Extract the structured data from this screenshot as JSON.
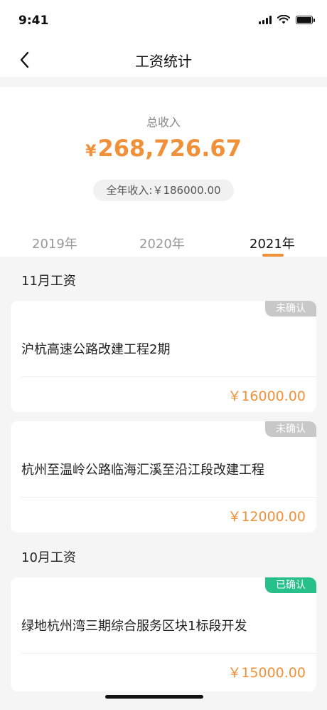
{
  "status_bar": {
    "time": "9:41"
  },
  "nav": {
    "title": "工资统计"
  },
  "summary": {
    "label": "总收入",
    "currency": "¥",
    "amount": "268,726.67",
    "annual": "全年收入:￥186000.00"
  },
  "year_tabs": [
    {
      "label": "2019年",
      "active": false
    },
    {
      "label": "2020年",
      "active": false
    },
    {
      "label": "2021年",
      "active": true
    }
  ],
  "months": [
    {
      "title": "11月工资",
      "cards": [
        {
          "badge": "未确认",
          "status": "pending",
          "project": "沪杭高速公路改建工程2期",
          "amount": "￥16000.00"
        },
        {
          "badge": "未确认",
          "status": "pending",
          "project": "杭州至温岭公路临海汇溪至沿江段改建工程",
          "amount": "￥12000.00"
        }
      ]
    },
    {
      "title": "10月工资",
      "cards": [
        {
          "badge": "已确认",
          "status": "confirmed",
          "project": "绿地杭州湾三期综合服务区块1标段开发",
          "amount": "￥15000.00"
        }
      ]
    }
  ],
  "colors": {
    "accent": "#f0913a",
    "confirmed": "#27c08a",
    "pending": "#c8c8c8"
  }
}
